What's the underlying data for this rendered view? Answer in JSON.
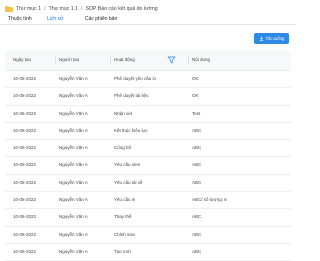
{
  "breadcrumb": {
    "items": [
      "Thư mục 1",
      "Thư mục 1.1",
      "SOP Báo cáo kết quả do lường"
    ]
  },
  "tabs": [
    {
      "label": "Thuộc tính"
    },
    {
      "label": "Lịch sử"
    },
    {
      "label": "Các phiên bản"
    }
  ],
  "active_tab": "Lịch sử",
  "toolbar": {
    "export_label": "Tải xuống"
  },
  "table": {
    "headers": [
      "Ngày tạo",
      "Người tạo",
      "Hoạt động",
      "Nội dung"
    ],
    "rows": [
      [
        "10-06-2022",
        "Nguyễn Văn A",
        "Phê duyệt yêu cầu in",
        "OK"
      ],
      [
        "10-06-2022",
        "Nguyễn Văn A",
        "Phê duyệt tài liệu",
        "OK"
      ],
      [
        "10-06-2022",
        "Nguyễn Văn A",
        "Nhận xét",
        "Test"
      ],
      [
        "10-06-2022",
        "Nguyễn Văn A",
        "Kết thúc hiệu lực",
        "ABC"
      ],
      [
        "10-06-2022",
        "Nguyễn Văn A",
        "Công bố",
        "ABC"
      ],
      [
        "10-06-2022",
        "Nguyễn Văn A",
        "Yêu cầu xem",
        "ABC"
      ],
      [
        "10-06-2022",
        "Nguyễn Văn A",
        "Yêu cầu tải về",
        "ABC"
      ],
      [
        "10-06-2022",
        "Nguyễn Văn A",
        "Yêu cầu in",
        "ABC/ số lượng: 6"
      ],
      [
        "10-06-2022",
        "Nguyễn Văn A",
        "Thay thế",
        "ABC"
      ],
      [
        "10-06-2022",
        "Nguyễn Văn A",
        "Chỉnh sửa",
        "ABC"
      ],
      [
        "10-06-2022",
        "Nguyễn Văn A",
        "Tạo mới",
        "ABC"
      ]
    ]
  },
  "colors": {
    "accent": "#1e7ae8",
    "button_bg": "#2f8ae6",
    "folder": "#f5c24c",
    "header_bg": "#f7f8fa"
  },
  "icons": {
    "folder": "folder-icon",
    "download": "download-icon",
    "filter": "filter-icon"
  }
}
